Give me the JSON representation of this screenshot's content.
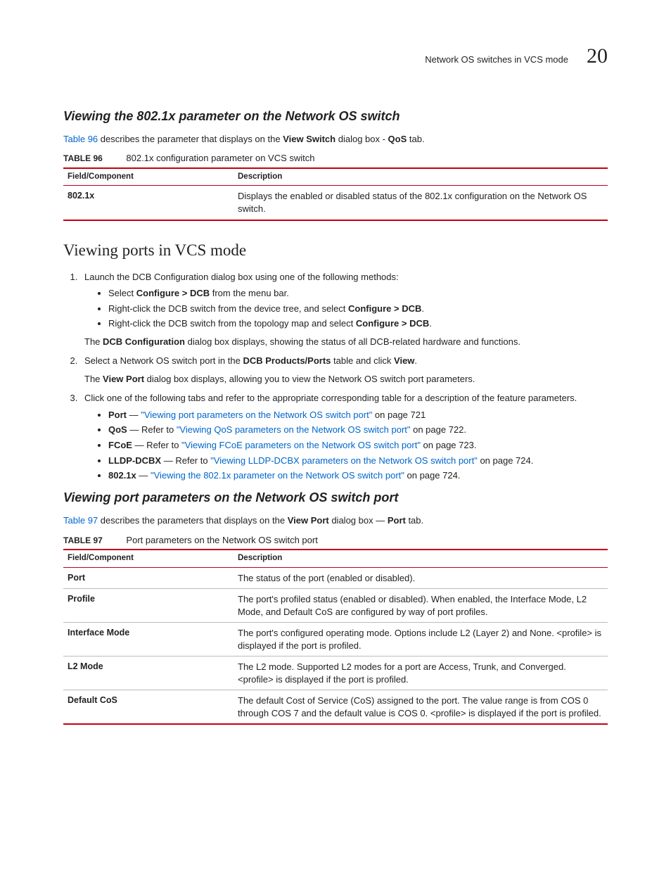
{
  "header": {
    "label": "Network OS switches in VCS mode",
    "chapter": "20"
  },
  "section1": {
    "title": "Viewing the 802.1x parameter on the Network OS switch",
    "intro_link": "Table 96",
    "intro_mid1": " describes the parameter that displays on the ",
    "intro_bold1": "View Switch",
    "intro_mid2": " dialog box - ",
    "intro_bold2": "QoS",
    "intro_end": " tab."
  },
  "table96": {
    "label": "TABLE 96",
    "caption": "802.1x configuration parameter on VCS switch",
    "col1": "Field/Component",
    "col2": "Description",
    "rows": [
      {
        "field": "802.1x",
        "desc": "Displays the enabled or disabled status of the 802.1x configuration on the Network OS switch."
      }
    ]
  },
  "section2": {
    "title": "Viewing ports in VCS mode",
    "steps": {
      "s1": "Launch the DCB Configuration dialog box using one of the following methods:",
      "s1_b1a": "Select ",
      "s1_b1b": "Configure > DCB",
      "s1_b1c": " from the menu bar.",
      "s1_b2a": "Right-click the DCB switch from the device tree, and select ",
      "s1_b2b": "Configure > DCB",
      "s1_b2c": ".",
      "s1_b3a": "Right-click the DCB switch from the topology map and select ",
      "s1_b3b": "Configure > DCB",
      "s1_b3c": ".",
      "s1_after_a": "The ",
      "s1_after_b": "DCB Configuration",
      "s1_after_c": " dialog box displays, showing the status of all DCB-related hardware and functions.",
      "s2a": "Select a Network OS switch port in the ",
      "s2b": "DCB Products/Ports",
      "s2c": " table and click ",
      "s2d": "View",
      "s2e": ".",
      "s2_after_a": "The ",
      "s2_after_b": "View Port",
      "s2_after_c": " dialog box displays, allowing you to view the Network OS switch port parameters.",
      "s3": "Click one of the following tabs and refer to the appropriate corresponding table for a description of the feature parameters.",
      "s3_b1_label": "Port",
      "s3_b1_dash": " — ",
      "s3_b1_link": "\"Viewing port parameters on the Network OS switch port\"",
      "s3_b1_tail": " on page 721",
      "s3_b2_label": "QoS",
      "s3_b2_dash": " — Refer to ",
      "s3_b2_link": "\"Viewing QoS parameters on the Network OS switch port\"",
      "s3_b2_tail": " on page 722.",
      "s3_b3_label": "FCoE",
      "s3_b3_dash": " — Refer to ",
      "s3_b3_link": "\"Viewing FCoE parameters on the Network OS switch port\"",
      "s3_b3_tail": " on page 723.",
      "s3_b4_label": "LLDP-DCBX",
      "s3_b4_dash": " — Refer to ",
      "s3_b4_link": "\"Viewing LLDP-DCBX parameters on the Network OS switch port\"",
      "s3_b4_tail": " on page 724.",
      "s3_b5_label": "802.1x",
      "s3_b5_dash": " — ",
      "s3_b5_link": "\"Viewing the 802.1x parameter on the Network OS switch port\"",
      "s3_b5_tail": " on page 724."
    }
  },
  "section3": {
    "title": "Viewing port parameters on the Network OS switch port",
    "intro_link": "Table 97",
    "intro_mid1": " describes the parameters that displays on the ",
    "intro_bold1": "View Port",
    "intro_mid2": " dialog box — ",
    "intro_bold2": "Port",
    "intro_end": " tab."
  },
  "table97": {
    "label": "TABLE 97",
    "caption": "Port parameters on the Network OS switch port",
    "col1": "Field/Component",
    "col2": "Description",
    "rows": [
      {
        "field": "Port",
        "desc": "The status of the port (enabled or disabled)."
      },
      {
        "field": "Profile",
        "desc": "The port's profiled status (enabled or disabled). When enabled, the Interface Mode, L2 Mode, and Default CoS are configured by way of port profiles."
      },
      {
        "field": "Interface Mode",
        "desc": "The port's configured operating mode. Options include L2 (Layer 2) and None. <profile> is displayed if the port is profiled."
      },
      {
        "field": "L2 Mode",
        "desc": "The L2 mode. Supported L2 modes for a port are Access, Trunk, and Converged. <profile> is displayed if the port is profiled."
      },
      {
        "field": "Default CoS",
        "desc": "The default Cost of Service (CoS) assigned to the port. The value range is from COS 0 through COS 7 and the default value is COS 0. <profile> is displayed if the port is profiled."
      }
    ]
  }
}
